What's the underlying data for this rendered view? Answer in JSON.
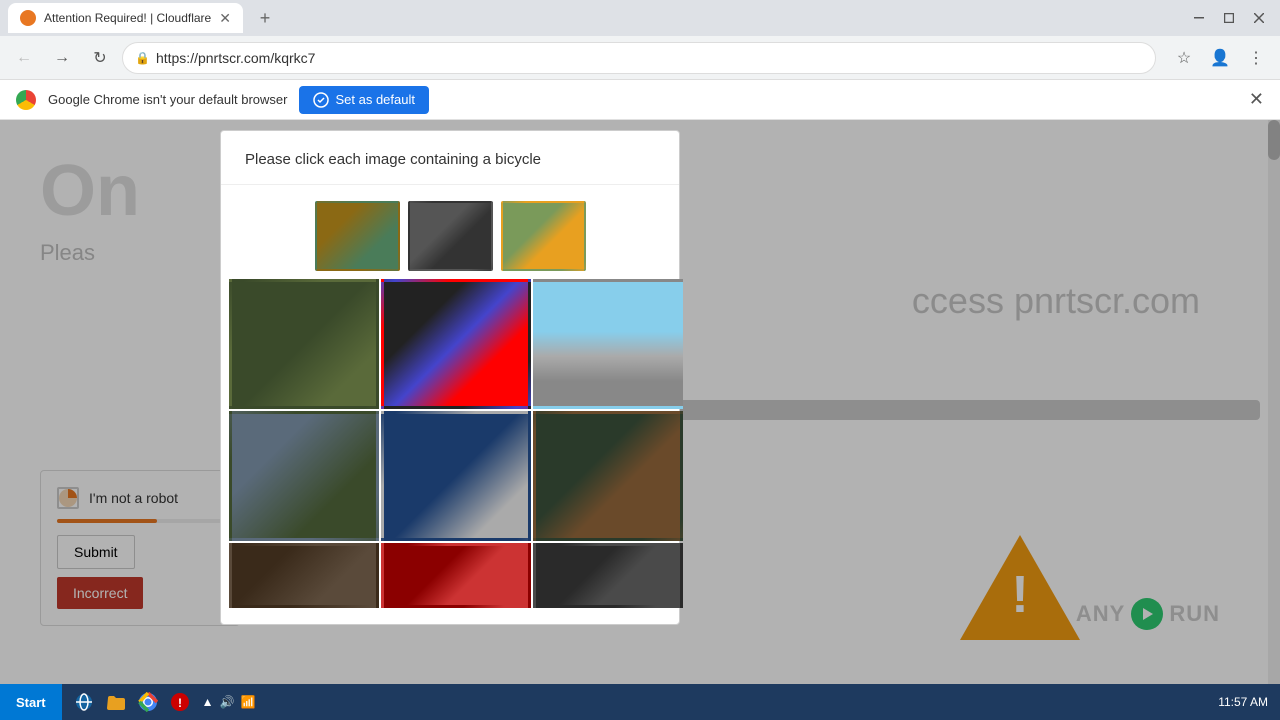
{
  "browser": {
    "tab_title": "Attention Required! | Cloudflare",
    "tab_favicon": "cf",
    "url": "https://pnrtscr.com/kqrkc7",
    "new_tab_label": "+",
    "back_btn": "←",
    "forward_btn": "→",
    "reload_btn": "↻",
    "info_bar_text": "Google Chrome isn't your default browser",
    "set_default_label": "Set as default"
  },
  "captcha": {
    "title": "Please click each image containing a bicycle",
    "submit_label": "Submit",
    "incorrect_label": "Incorrect"
  },
  "page": {
    "title_partial": "On",
    "subtitle_partial": "Pleas",
    "right_text": "ccess pnrtscr.com"
  },
  "taskbar": {
    "start_label": "Start",
    "time": "11:57 AM"
  },
  "warning": {
    "symbol": "!"
  }
}
